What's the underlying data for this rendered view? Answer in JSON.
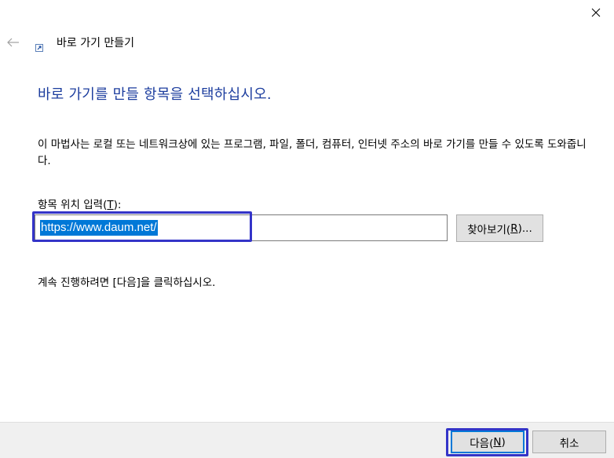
{
  "window": {
    "title": "바로 가기 만들기"
  },
  "heading": "바로 가기를 만들 항목을 선택하십시오.",
  "description": "이 마법사는 로컬 또는 네트워크상에 있는 프로그램, 파일, 폴더, 컴퓨터, 인터넷 주소의 바로 가기를 만들 수 있도록 도와줍니다.",
  "location_field": {
    "label_prefix": "항목 위치 입력(",
    "label_mnemonic": "T",
    "label_suffix": "):",
    "value": "https://www.daum.net/"
  },
  "browse_button": {
    "label_prefix": "찾아보기(",
    "label_mnemonic": "R",
    "label_suffix": ")..."
  },
  "instruction": "계속 진행하려면 [다음]을 클릭하십시오.",
  "footer": {
    "next_prefix": "다음(",
    "next_mnemonic": "N",
    "next_suffix": ")",
    "cancel_label": "취소"
  },
  "icons": {
    "close": "close-icon",
    "back": "back-arrow-icon",
    "title": "shortcut-icon"
  },
  "colors": {
    "heading": "#1c3d9e",
    "selection": "#0078d7",
    "annotation_box": "#3434c8",
    "footer_bg": "#f0f0f0",
    "button_bg": "#e1e1e1"
  }
}
